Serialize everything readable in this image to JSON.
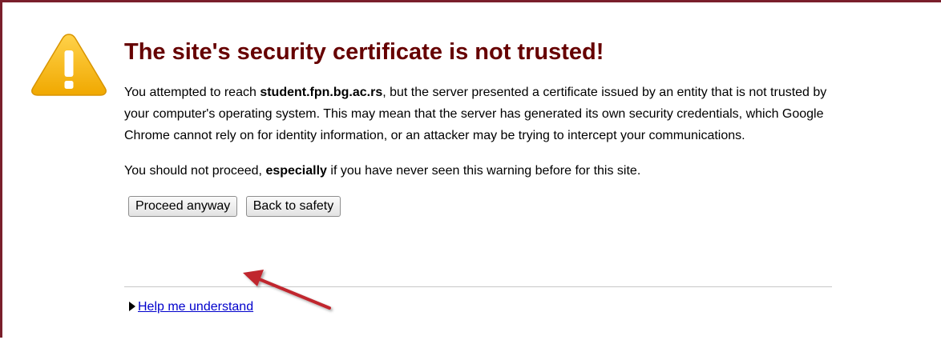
{
  "page": {
    "title": "The site's security certificate is not trusted!"
  },
  "icon": {
    "name": "warning-icon",
    "color": "#f5b400"
  },
  "message": {
    "p1_prefix": "You attempted to reach ",
    "p1_host": "student.fpn.bg.ac.rs",
    "p1_suffix": ", but the server presented a certificate issued by an entity that is not trusted by your computer's operating system. This may mean that the server has generated its own security credentials, which Google Chrome cannot rely on for identity information, or an attacker may be trying to intercept your communications.",
    "p2_prefix": "You should not proceed, ",
    "p2_emphasis": "especially",
    "p2_suffix": " if you have never seen this warning before for this site."
  },
  "buttons": {
    "proceed_label": "Proceed anyway",
    "back_label": "Back to safety"
  },
  "help": {
    "link_label": "Help me understand"
  },
  "colors": {
    "title": "#660000",
    "border": "#7a1f2b",
    "link": "#0000cc",
    "annotation_arrow": "#c0272d"
  }
}
